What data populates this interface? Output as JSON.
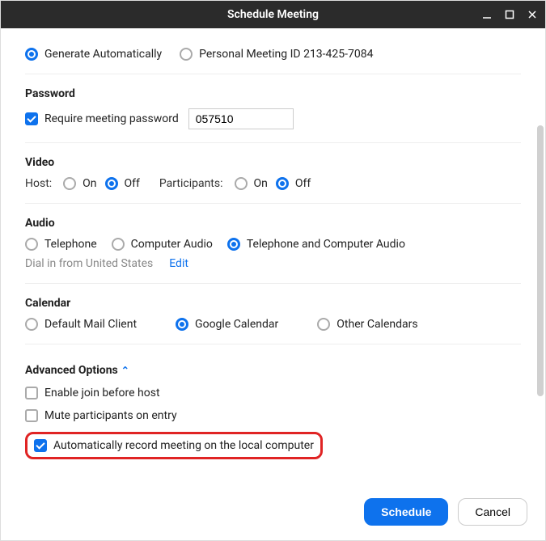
{
  "window": {
    "title": "Schedule Meeting"
  },
  "meetingId": {
    "generate": "Generate Automatically",
    "personal": "Personal Meeting ID 213-425-7084"
  },
  "password": {
    "label": "Password",
    "require": "Require meeting password",
    "value": "057510"
  },
  "video": {
    "label": "Video",
    "host": "Host:",
    "participants": "Participants:",
    "on": "On",
    "off": "Off"
  },
  "audio": {
    "label": "Audio",
    "telephone": "Telephone",
    "computer": "Computer Audio",
    "both": "Telephone and Computer Audio",
    "dial": "Dial in from United States",
    "edit": "Edit"
  },
  "calendar": {
    "label": "Calendar",
    "default": "Default Mail Client",
    "google": "Google Calendar",
    "other": "Other Calendars"
  },
  "advanced": {
    "label": "Advanced Options",
    "join": "Enable join before host",
    "mute": "Mute participants on entry",
    "record": "Automatically record meeting on the local computer"
  },
  "buttons": {
    "schedule": "Schedule",
    "cancel": "Cancel"
  }
}
